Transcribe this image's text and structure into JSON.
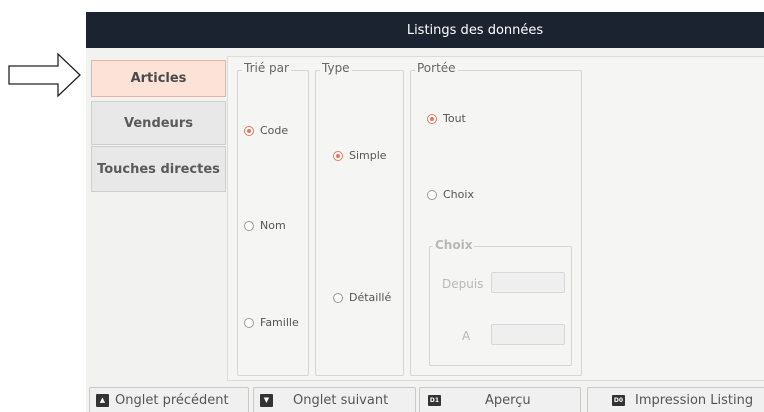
{
  "window": {
    "title": "Listings des données"
  },
  "tabs": [
    {
      "label": "Articles",
      "active": true
    },
    {
      "label": "Vendeurs",
      "active": false
    },
    {
      "label": "Touches directes",
      "active": false
    }
  ],
  "sort_group": {
    "legend": "Trié par",
    "options": [
      {
        "label": "Code",
        "selected": true
      },
      {
        "label": "Nom",
        "selected": false
      },
      {
        "label": "Famille",
        "selected": false
      }
    ]
  },
  "type_group": {
    "legend": "Type",
    "options": [
      {
        "label": "Simple",
        "selected": true
      },
      {
        "label": "Détaillé",
        "selected": false
      }
    ]
  },
  "scope_group": {
    "legend": "Portée",
    "options": [
      {
        "label": "Tout",
        "selected": true
      },
      {
        "label": "Choix",
        "selected": false
      }
    ],
    "choice_box": {
      "legend": "Choix",
      "from_label": "Depuis",
      "from_value": "",
      "to_label": "A",
      "to_value": ""
    }
  },
  "buttons": {
    "prev_tab": {
      "label": "Onglet précédent",
      "icon": "printer-arrow-icon"
    },
    "next_tab": {
      "label": "Onglet suivant",
      "icon": "printer-arrow-icon"
    },
    "preview": {
      "label": "Aperçu",
      "icon_text": "D1"
    },
    "print": {
      "label": "Impression Listing",
      "icon_text": "D0"
    }
  },
  "colors": {
    "titlebar": "#1c2330",
    "active_tab": "#fde2d8",
    "radio_accent": "#e8765a"
  }
}
